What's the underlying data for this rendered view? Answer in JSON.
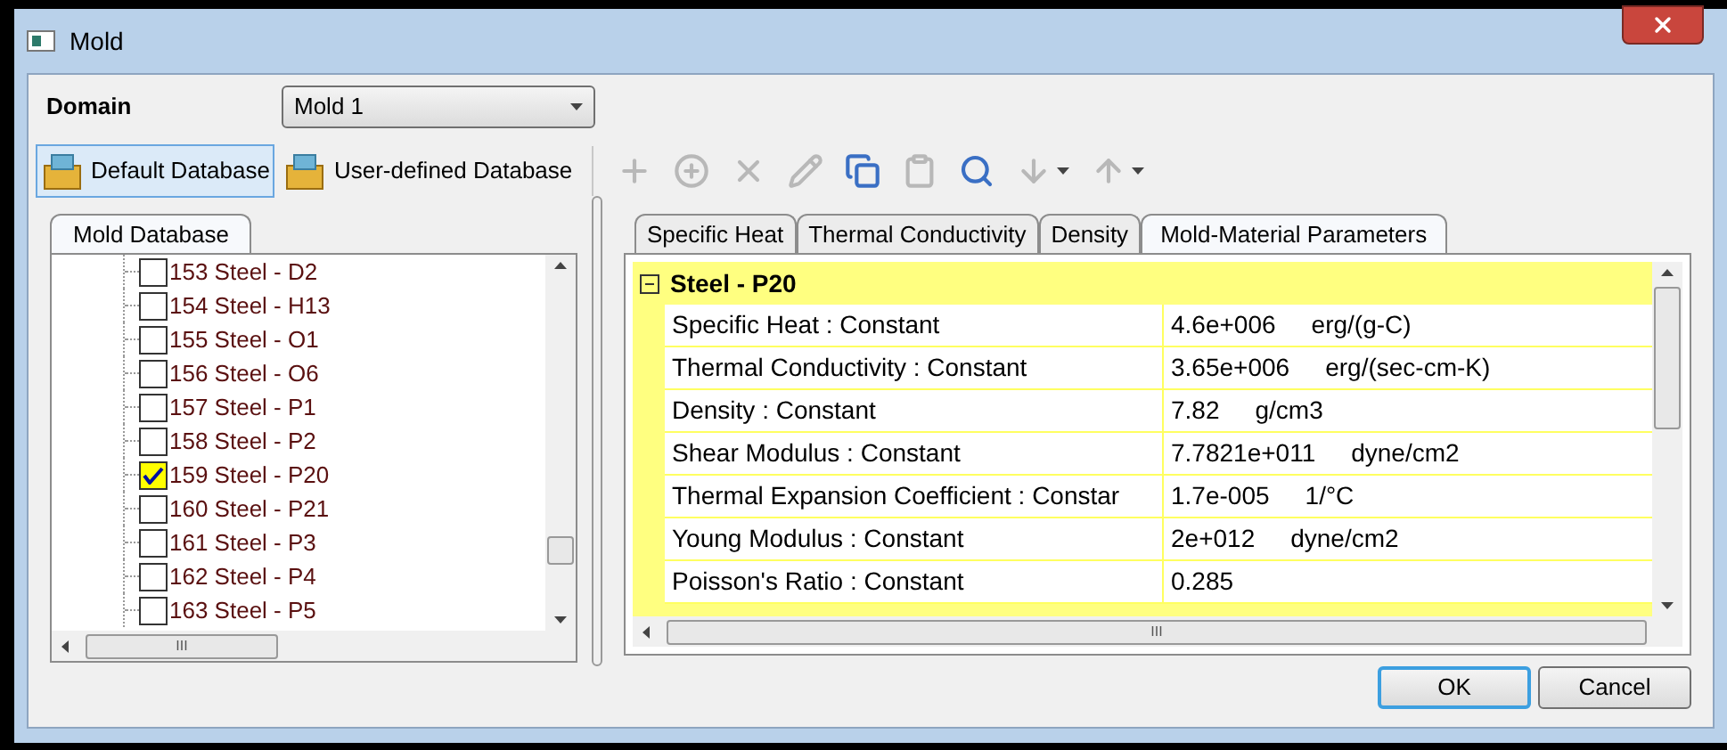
{
  "window": {
    "title": "Mold"
  },
  "domain": {
    "label": "Domain",
    "value": "Mold 1"
  },
  "database_buttons": [
    {
      "label": "Default Database",
      "selected": true
    },
    {
      "label": "User-defined Database",
      "selected": false
    }
  ],
  "toolbar": [
    {
      "kind": "add",
      "disabled": true,
      "dropdown": false
    },
    {
      "kind": "add-more",
      "disabled": true,
      "dropdown": false
    },
    {
      "kind": "delete",
      "disabled": true,
      "dropdown": false
    },
    {
      "kind": "edit",
      "disabled": true,
      "dropdown": false
    },
    {
      "kind": "copy",
      "disabled": false,
      "dropdown": false
    },
    {
      "kind": "paste",
      "disabled": true,
      "dropdown": false
    },
    {
      "kind": "inspect",
      "disabled": false,
      "dropdown": false
    },
    {
      "kind": "import",
      "disabled": true,
      "dropdown": true
    },
    {
      "kind": "export",
      "disabled": true,
      "dropdown": true
    }
  ],
  "left_tabs": [
    {
      "label": "Mold Database",
      "selected": true
    }
  ],
  "tree": [
    {
      "label": "153 Steel - D2",
      "checked": false
    },
    {
      "label": "154 Steel - H13",
      "checked": false
    },
    {
      "label": "155 Steel - O1",
      "checked": false
    },
    {
      "label": "156 Steel - O6",
      "checked": false
    },
    {
      "label": "157 Steel - P1",
      "checked": false
    },
    {
      "label": "158 Steel - P2",
      "checked": false
    },
    {
      "label": "159 Steel - P20",
      "checked": true
    },
    {
      "label": "160 Steel - P21",
      "checked": false
    },
    {
      "label": "161 Steel - P3",
      "checked": false
    },
    {
      "label": "162 Steel - P4",
      "checked": false
    },
    {
      "label": "163 Steel - P5",
      "checked": false
    }
  ],
  "right_tabs": [
    {
      "label": "Specific Heat",
      "selected": false
    },
    {
      "label": "Thermal Conductivity",
      "selected": false
    },
    {
      "label": "Density",
      "selected": false
    },
    {
      "label": "Mold-Material Parameters",
      "selected": true
    }
  ],
  "group": {
    "title": "Steel - P20",
    "expanded": true
  },
  "properties": [
    {
      "name": "Specific Heat : Constant",
      "value": "4.6e+006",
      "unit": "erg/(g-C)"
    },
    {
      "name": "Thermal Conductivity : Constant",
      "value": "3.65e+006",
      "unit": "erg/(sec-cm-K)"
    },
    {
      "name": "Density : Constant",
      "value": "7.82",
      "unit": "g/cm3"
    },
    {
      "name": "Shear Modulus : Constant",
      "value": "7.7821e+011",
      "unit": "dyne/cm2"
    },
    {
      "name": "Thermal Expansion Coefficient : Constar",
      "value": "1.7e-005",
      "unit": "1/°C"
    },
    {
      "name": "Young Modulus : Constant",
      "value": "2e+012",
      "unit": "dyne/cm2"
    },
    {
      "name": "Poisson's Ratio : Constant",
      "value": "0.285"
    }
  ],
  "left_hscroll_label": "III",
  "right_hscroll_label": "III",
  "buttons": [
    {
      "label": "OK",
      "kind": "default"
    },
    {
      "label": "Cancel",
      "kind": "normal"
    }
  ]
}
